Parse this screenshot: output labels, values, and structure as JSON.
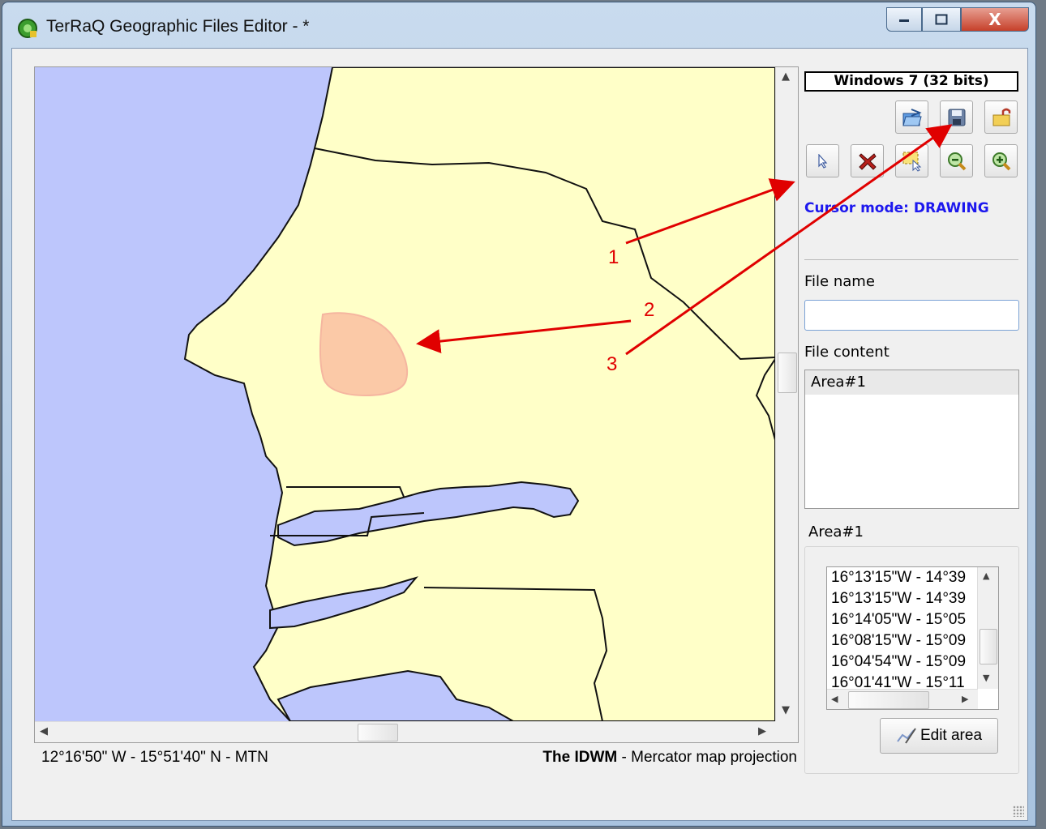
{
  "window": {
    "title": "TerRaQ Geographic Files Editor - *",
    "minimize_icon": "minimize-icon",
    "maximize_icon": "maximize-icon",
    "close_label": "X"
  },
  "toolbar": {
    "os_badge": "Windows 7 (32 bits)",
    "row1": [
      "open-folder-icon",
      "save-disk-icon",
      "unlock-icon"
    ],
    "row2": [
      "select-cursor-icon",
      "delete-x-icon",
      "select-area-icon",
      "zoom-out-icon",
      "zoom-in-icon"
    ],
    "cursor_mode": "Cursor mode: DRAWING"
  },
  "file": {
    "name_label": "File name",
    "name_value": "",
    "content_label": "File content",
    "content_items": [
      "Area#1"
    ]
  },
  "area": {
    "title": "Area#1",
    "coords": [
      "16°13'15\"W - 14°39",
      "16°13'15\"W - 14°39",
      "16°14'05\"W - 15°05",
      "16°08'15\"W - 15°09",
      "16°04'54\"W - 15°09",
      "16°01'41\"W - 15°11"
    ],
    "edit_label": "Edit area"
  },
  "status": {
    "coords": "12°16'50\" W - 15°51'40\" N - MTN",
    "brand": "The IDWM",
    "projection": " - Mercator map projection"
  },
  "annotations": [
    "1",
    "2",
    "3"
  ],
  "colors": {
    "sea": "#bdc6fc",
    "land": "#ffffc8",
    "area_fill": "#fbc9a7",
    "arrow": "#e00000",
    "cursor_mode": "#1d18ee"
  }
}
